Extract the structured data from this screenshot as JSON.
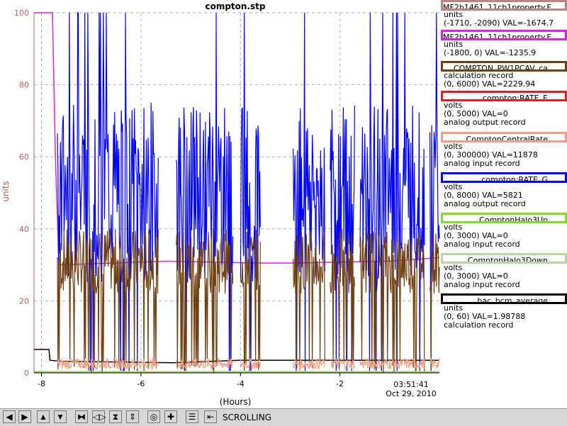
{
  "window": {
    "title": "compton.stp"
  },
  "chart_data": {
    "type": "line",
    "title": "compton.stp",
    "xlabel": "(Hours)",
    "ylabel": "units",
    "xlim": [
      -8.15,
      0.0
    ],
    "ylim": [
      0,
      100
    ],
    "xticks": [
      -8,
      -6,
      -4,
      -2
    ],
    "yticks": [
      0,
      20,
      40,
      60,
      80,
      100
    ],
    "end_time_label": "03:51:41",
    "end_date_label": "Oct 29, 2010",
    "grid": true,
    "gaps": [
      [
        -5.65,
        -5.3
      ],
      [
        -4.15,
        -4.0
      ],
      [
        -3.6,
        -2.95
      ],
      [
        -2.3,
        -2.2
      ],
      [
        -1.7,
        -1.6
      ],
      [
        -0.3,
        -0.2
      ]
    ],
    "series": [
      {
        "name": "MF2b1461_11ch1property.F",
        "color": "#c08080",
        "units": "units",
        "range": "(-1710, -2090)",
        "val": "VAL=-1674.7",
        "extra": "",
        "style": "flat",
        "x": [
          -8.15,
          0.0
        ],
        "y": [
          -1,
          -1
        ]
      },
      {
        "name": "MF2b1461_11ch1property.E",
        "color": "#e020e0",
        "units": "units",
        "range": "(-1800, 0)",
        "val": "VAL=-1235.9",
        "extra": "",
        "style": "steps",
        "x": [
          -8.15,
          -7.78,
          -7.72,
          -7.65,
          -5.5,
          -3.6,
          -2.95,
          -1.0,
          0.0
        ],
        "y": [
          100,
          100,
          60,
          30,
          31,
          30.5,
          30.5,
          31,
          32
        ]
      },
      {
        "name": "COMPTON_PW1PCAV_ca",
        "color": "#704010",
        "units": "calculation record",
        "range": "(0, 6000)",
        "val": "VAL=2229.94",
        "extra": "",
        "style": "noise",
        "x": [
          -7.68,
          0.0
        ],
        "y": [
          0,
          40
        ]
      },
      {
        "name": "compton:RATE_E",
        "color": "#e02020",
        "units": "volts",
        "range": "(0, 5000)",
        "val": "VAL=0",
        "extra": "analog output record",
        "style": "flat",
        "x": [
          -8.15,
          0.0
        ],
        "y": [
          -1,
          -1
        ]
      },
      {
        "name": "ComptonCentralRate",
        "color": "#f0a080",
        "units": "volts",
        "range": "(0, 300000)",
        "val": "VAL=11878",
        "extra": "analog input record",
        "style": "lownoise",
        "x": [
          -7.68,
          0.0
        ],
        "y": [
          1,
          4
        ]
      },
      {
        "name": "compton:RATE_G",
        "color": "#0000ff",
        "units": "volts",
        "range": "(0, 8000)",
        "val": "VAL=5821",
        "extra": "analog output record",
        "style": "noise",
        "x": [
          -7.68,
          0.0
        ],
        "y": [
          25,
          75
        ]
      },
      {
        "name": "ComptonHalo3Up",
        "color": "#80e020",
        "units": "volts",
        "range": "(0, 3000)",
        "val": "VAL=0",
        "extra": "analog input record",
        "style": "flat",
        "x": [
          -8.15,
          0.0
        ],
        "y": [
          0.2,
          0.2
        ]
      },
      {
        "name": "ComptonHalo3Down",
        "color": "#b8d8a0",
        "units": "volts",
        "range": "(0, 3000)",
        "val": "VAL=0",
        "extra": "analog input record",
        "style": "flat",
        "x": [
          -8.15,
          0.0
        ],
        "y": [
          0.4,
          0.4
        ]
      },
      {
        "name": "hac_bcm_average",
        "color": "#000000",
        "units": "units",
        "range": "(0, 60)",
        "val": "VAL=1.98788",
        "extra": "calculation record",
        "style": "steps",
        "x": [
          -8.15,
          -7.85,
          -7.83,
          -7.6,
          -5.35,
          -4.0,
          -0.5,
          0.0
        ],
        "y": [
          6.5,
          6.5,
          3.5,
          3.2,
          2.8,
          3.5,
          3.5,
          3.5
        ]
      }
    ]
  },
  "toolbar": {
    "buttons": [
      {
        "name": "pan-left-button",
        "glyph": "◀"
      },
      {
        "name": "pan-right-button",
        "glyph": "▶"
      },
      {
        "name": "pan-up-button",
        "glyph": "▲"
      },
      {
        "name": "pan-down-button",
        "glyph": "▼"
      },
      {
        "name": "zoom-in-x-button",
        "glyph": "⧓"
      },
      {
        "name": "zoom-out-x-button",
        "glyph": "◁▷"
      },
      {
        "name": "zoom-in-y-button",
        "glyph": "⧗"
      },
      {
        "name": "zoom-out-y-button",
        "glyph": "⇕"
      },
      {
        "name": "auto-scale-button",
        "glyph": "◎"
      },
      {
        "name": "add-button",
        "glyph": "✚"
      },
      {
        "name": "config-button",
        "glyph": "☰"
      },
      {
        "name": "back-to-scroll-button",
        "glyph": "⇤"
      }
    ],
    "status_label": "SCROLLING"
  }
}
